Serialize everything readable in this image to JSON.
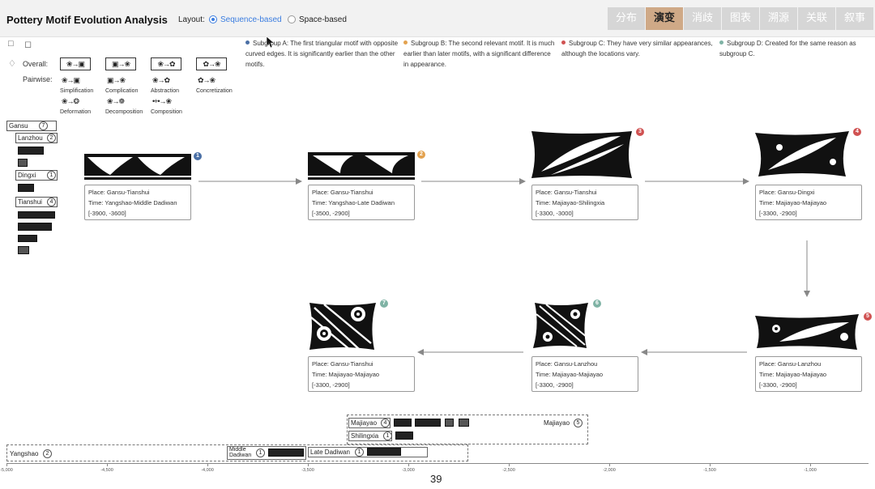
{
  "header": {
    "title": "Pottery Motif Evolution Analysis",
    "layout_label": "Layout:",
    "layout_options": [
      "Sequence-based",
      "Space-based"
    ],
    "selected_layout": "Sequence-based",
    "tabs": [
      "分布",
      "演变",
      "消歧",
      "图表",
      "溯源",
      "关联",
      "叙事"
    ],
    "active_tab": "演变"
  },
  "legend": [
    {
      "text": "Subgroup A: The first triangular motif with opposite curved edges. It is significantly earlier than the other motifs.",
      "color": "#4a6fa5"
    },
    {
      "text": "Subgroup B: The second relevant motif. It is much earlier than later motifs, with a significant difference in appearance.",
      "color": "#e3a24f"
    },
    {
      "text": "Subgroup C: They have very similar appearances, although the locations vary.",
      "color": "#d05252"
    },
    {
      "text": "Subgroup D: Created for the same reason as subgroup C.",
      "color": "#7fb3a5"
    }
  ],
  "operations": {
    "overall_label": "Overall:",
    "pairwise_label": "Pairwise:",
    "pairwise": [
      "Simplification",
      "Complication",
      "Abstraction",
      "Concretization",
      "Deformation",
      "Decomposition",
      "Composition"
    ]
  },
  "tree": {
    "root": {
      "name": "Gansu",
      "count": "7"
    },
    "children": [
      {
        "name": "Lanzhou",
        "count": "2"
      },
      {
        "name": "Dingxi",
        "count": "1"
      },
      {
        "name": "Tianshui",
        "count": "4"
      }
    ]
  },
  "cards": [
    {
      "place": "Place: Gansu-Tianshui",
      "time": "Time: Yangshao-Middle Dadiwan",
      "range": "[-3900, -3600]",
      "badge": "1",
      "color": "#4a6fa5"
    },
    {
      "place": "Place: Gansu-Tianshui",
      "time": "Time: Yangshao-Late Dadiwan",
      "range": "[-3500, -2900]",
      "badge": "2",
      "color": "#e3a24f"
    },
    {
      "place": "Place: Gansu-Tianshui",
      "time": "Time: Majiayao-Shilingxia",
      "range": "[-3300, -3000]",
      "badge": "3",
      "color": "#d05252"
    },
    {
      "place": "Place: Gansu-Dingxi",
      "time": "Time: Majiayao-Majiayao",
      "range": "[-3300, -2900]",
      "badge": "4",
      "color": "#d05252"
    },
    {
      "place": "Place: Gansu-Lanzhou",
      "time": "Time: Majiayao-Majiayao",
      "range": "[-3300, -2900]",
      "badge": "5",
      "color": "#d05252"
    },
    {
      "place": "Place: Gansu-Lanzhou",
      "time": "Time: Majiayao-Majiayao",
      "range": "[-3300, -2900]",
      "badge": "6",
      "color": "#7fb3a5"
    },
    {
      "place": "Place: Gansu-Tianshui",
      "time": "Time: Majiayao-Majiayao",
      "range": "[-3300, -2900]",
      "badge": "7",
      "color": "#7fb3a5"
    }
  ],
  "timeline": {
    "majiayao": {
      "name": "Majiayao",
      "count": "4"
    },
    "majiayao_right": {
      "name": "Majiayao",
      "count": "5"
    },
    "shilingxia": {
      "name": "Shilingxia",
      "count": "1"
    },
    "yangshao": {
      "name": "Yangshao",
      "count": "2"
    },
    "middle_dadiwan": {
      "name": "Middle Dadiwan",
      "count": "1"
    },
    "late_dadiwan": {
      "name": "Late Dadiwan",
      "count": "1"
    },
    "ticks": [
      "-5,000",
      "-4,500",
      "-4,000",
      "-3,500",
      "-3,000",
      "-2,500",
      "-2,000",
      "-1,500",
      "-1,000"
    ]
  },
  "page_number": "39",
  "colors": {
    "accent": "#3b7de0",
    "tab_active": "#cfa987",
    "tab": "#d6d6d6"
  }
}
